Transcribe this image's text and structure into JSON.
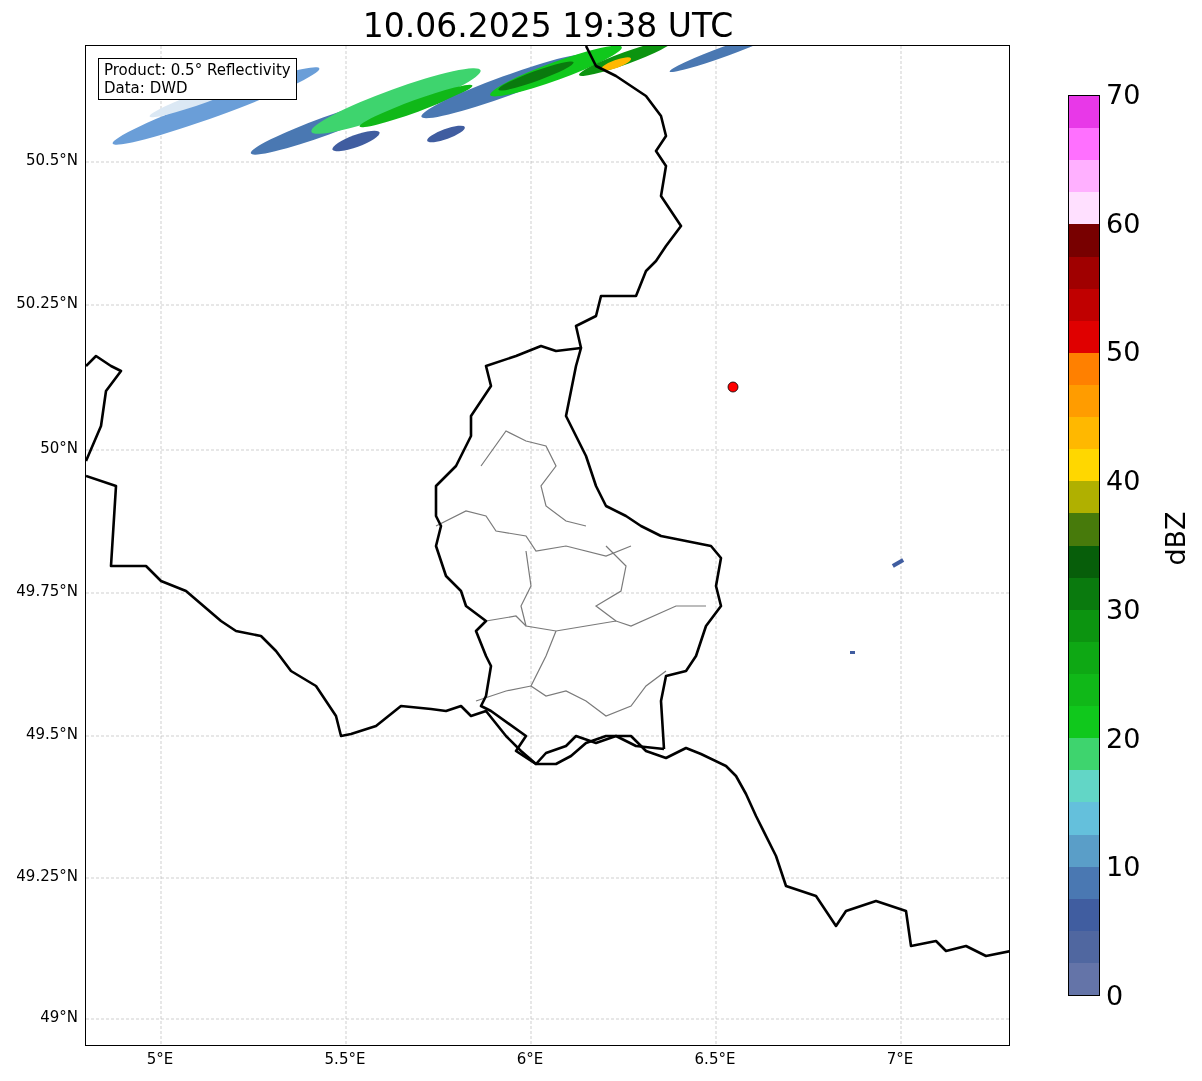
{
  "title": "10.06.2025 19:38 UTC",
  "annotation": [
    "Product: 0.5° Reflectivity",
    "Data: DWD"
  ],
  "map": {
    "y_ticks": [
      "50.5°N",
      "50.25°N",
      "50°N",
      "49.75°N",
      "49.5°N",
      "49.25°N",
      "49°N"
    ],
    "x_ticks": [
      "5°E",
      "5.5°E",
      "6°E",
      "6.5°E",
      "7°E"
    ]
  },
  "colorbar": {
    "label": "dBZ",
    "ticks": [
      "70",
      "60",
      "50",
      "40",
      "30",
      "20",
      "10",
      "0"
    ],
    "bins": [
      {
        "color": "#e838e8"
      },
      {
        "color": "#ff70ff"
      },
      {
        "color": "#ffb0ff"
      },
      {
        "color": "#ffe0ff"
      },
      {
        "color": "#780000"
      },
      {
        "color": "#a00000"
      },
      {
        "color": "#c00000"
      },
      {
        "color": "#e00000"
      },
      {
        "color": "#ff8000"
      },
      {
        "color": "#ff9c00"
      },
      {
        "color": "#ffb800"
      },
      {
        "color": "#ffd700"
      },
      {
        "color": "#b0b000"
      },
      {
        "color": "#477a0b"
      },
      {
        "color": "#075e0a"
      },
      {
        "color": "#0a7a0e"
      },
      {
        "color": "#0c9410"
      },
      {
        "color": "#0ea814"
      },
      {
        "color": "#10b818"
      },
      {
        "color": "#10c81c"
      },
      {
        "color": "#3ed46e"
      },
      {
        "color": "#62d6c6"
      },
      {
        "color": "#64c0dc"
      },
      {
        "color": "#5a9ec8"
      },
      {
        "color": "#4a78b2"
      },
      {
        "color": "#405da0"
      },
      {
        "color": "#5067a0"
      },
      {
        "color": "#6474a8"
      }
    ]
  }
}
